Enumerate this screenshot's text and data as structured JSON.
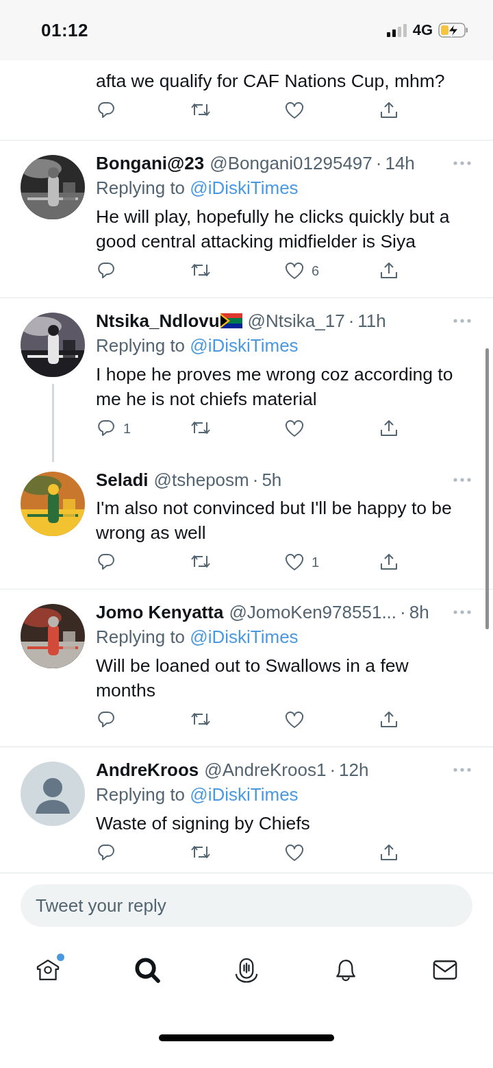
{
  "status_bar": {
    "time": "01:12",
    "network": "4G",
    "charging": true
  },
  "tweets": [
    {
      "kind": "partial",
      "text": "afta we qualify for CAF Nations Cup, mhm?"
    },
    {
      "kind": "full",
      "name": "Bongani@23",
      "handle": "@Bongani01295497",
      "separator": "·",
      "time": "14h",
      "replying_label": "Replying to",
      "replying_to": "@iDiskiTimes",
      "text": "He will play, hopefully he clicks quickly but a good central attacking midfielder is Siya",
      "actions": {
        "like_count": "6"
      }
    },
    {
      "kind": "full",
      "name": "Ntsika_Ndlovu",
      "has_flag": true,
      "handle": "@Ntsika_17",
      "separator": "·",
      "time": "11h",
      "replying_label": "Replying to",
      "replying_to": "@iDiskiTimes",
      "text": "I hope he proves me wrong coz according to me he is not chiefs material",
      "actions": {
        "reply_count": "1"
      },
      "children": [
        {
          "kind": "full",
          "name": "Seladi",
          "handle": "@tsheposm",
          "separator": "·",
          "time": "5h",
          "text": "I'm also not convinced but I'll be happy to be wrong as well",
          "actions": {
            "like_count": "1"
          }
        }
      ]
    },
    {
      "kind": "full",
      "name": "Jomo Kenyatta",
      "handle": "@JomoKen978551...",
      "separator": "·",
      "time": "8h",
      "replying_label": "Replying to",
      "replying_to": "@iDiskiTimes",
      "text": "Will be loaned out to Swallows in a few months"
    },
    {
      "kind": "full",
      "avatar": {
        "kind": "default"
      },
      "name": "AndreKroos",
      "handle": "@AndreKroos1",
      "separator": "·",
      "time": "12h",
      "replying_label": "Replying to",
      "replying_to": "@iDiskiTimes",
      "text": "Waste of signing by Chiefs"
    }
  ],
  "reply_box": {
    "placeholder": "Tweet your reply"
  },
  "tab_bar": [
    {
      "kind": "home",
      "selected": false,
      "badge": true
    },
    {
      "kind": "search",
      "selected": true
    },
    {
      "kind": "spaces",
      "selected": false
    },
    {
      "kind": "notifications",
      "selected": false
    },
    {
      "kind": "messages",
      "selected": false
    }
  ]
}
